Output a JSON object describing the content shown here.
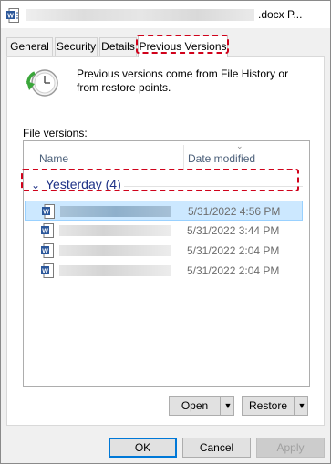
{
  "window": {
    "title_visible_suffix": ".docx P..."
  },
  "tabs": [
    {
      "label": "General",
      "active": false
    },
    {
      "label": "Security",
      "active": false
    },
    {
      "label": "Details",
      "active": false
    },
    {
      "label": "Previous Versions",
      "active": true
    }
  ],
  "panel": {
    "description": "Previous versions come from File History or from restore points.",
    "file_versions_label": "File versions:"
  },
  "list": {
    "columns": {
      "name": "Name",
      "date_modified": "Date modified"
    },
    "group_label": "Yesterday (4)",
    "rows": [
      {
        "date": "5/31/2022 4:56 PM",
        "selected": true
      },
      {
        "date": "5/31/2022 3:44 PM",
        "selected": false
      },
      {
        "date": "5/31/2022 2:04 PM",
        "selected": false
      },
      {
        "date": "5/31/2022 2:04 PM",
        "selected": false
      }
    ]
  },
  "actions": {
    "open": "Open",
    "restore": "Restore"
  },
  "footer": {
    "ok": "OK",
    "cancel": "Cancel",
    "apply": "Apply"
  },
  "colors": {
    "highlight": "#d0021b",
    "selection": "#cce8ff",
    "group_text": "#1e3287",
    "word_blue": "#2b579a"
  },
  "icons": {
    "title": "word-document-icon",
    "history": "file-history-restore-icon",
    "row": "word-document-icon"
  }
}
